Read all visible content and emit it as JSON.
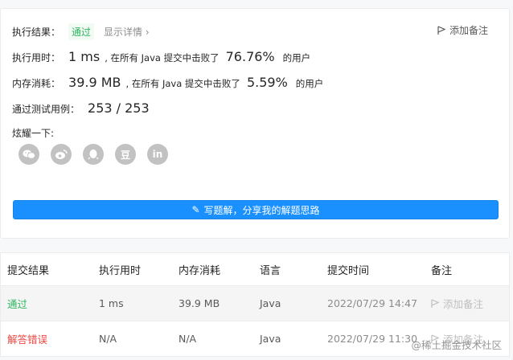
{
  "result": {
    "label": "执行结果：",
    "status": "通过",
    "details_link": "显示详情 ›",
    "add_note": "添加备注"
  },
  "runtime": {
    "label": "执行用时：",
    "value": "1 ms",
    "prefix": ", 在所有 Java 提交中击败了",
    "percent": "76.76%",
    "suffix": "的用户"
  },
  "memory": {
    "label": "内存消耗：",
    "value": "39.9 MB",
    "prefix": ", 在所有 Java 提交中击败了",
    "percent": "5.59%",
    "suffix": "的用户"
  },
  "tests": {
    "label": "通过测试用例：",
    "value": "253 / 253"
  },
  "share": {
    "label": "炫耀一下:",
    "icons": [
      "wechat-icon",
      "weibo-icon",
      "qq-icon",
      "douban-icon",
      "linkedin-icon"
    ],
    "douban_glyph": "豆",
    "linkedin_glyph": "in"
  },
  "write_button": "写题解，分享我的解题思路",
  "table": {
    "headers": [
      "提交结果",
      "执行用时",
      "内存消耗",
      "语言",
      "提交时间",
      "备注"
    ],
    "rows": [
      {
        "result": "通过",
        "runtime": "1 ms",
        "memory": "39.9 MB",
        "lang": "Java",
        "time": "2022/07/29 14:47",
        "note": "添加备注"
      },
      {
        "result": "解答错误",
        "runtime": "N/A",
        "memory": "N/A",
        "lang": "Java",
        "time": "2022/07/29 11:30",
        "note": "添加备注"
      }
    ]
  },
  "watermark": "@稀土掘金技术社区",
  "colors": {
    "accent": "#1a90ff",
    "success": "#2db55d",
    "error": "#ef4743"
  }
}
